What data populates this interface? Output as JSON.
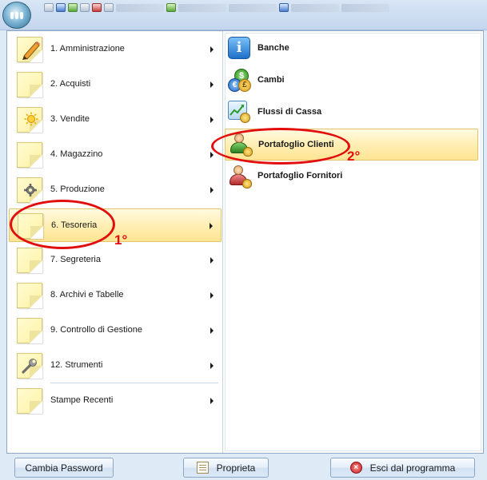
{
  "menu": {
    "items": [
      {
        "label": "1. Amministrazione",
        "icon": "pencil-note-icon"
      },
      {
        "label": "2. Acquisti",
        "icon": "note-icon"
      },
      {
        "label": "3. Vendite",
        "icon": "sun-note-icon"
      },
      {
        "label": "4. Magazzino",
        "icon": "note-icon"
      },
      {
        "label": "5. Produzione",
        "icon": "gear-note-icon"
      },
      {
        "label": "6. Tesoreria",
        "icon": "note-icon",
        "selected": true
      },
      {
        "label": "7. Segreteria",
        "icon": "note-icon"
      },
      {
        "label": "8. Archivi e Tabelle",
        "icon": "note-icon"
      },
      {
        "label": "9. Controllo di Gestione",
        "icon": "note-icon"
      },
      {
        "label": "12. Strumenti",
        "icon": "wrench-note-icon"
      },
      {
        "label": "Stampe Recenti",
        "icon": "note-icon"
      }
    ]
  },
  "submenu": {
    "items": [
      {
        "label": "Banche",
        "icon": "info-icon"
      },
      {
        "label": "Cambi",
        "icon": "currency-coins-icon"
      },
      {
        "label": "Flussi di Cassa",
        "icon": "cash-flow-chart-icon"
      },
      {
        "label": "Portafoglio Clienti",
        "icon": "customer-portfolio-icon",
        "selected": true
      },
      {
        "label": "Portafoglio Fornitori",
        "icon": "supplier-portfolio-icon"
      }
    ]
  },
  "footer": {
    "change_password": "Cambia Password",
    "properties": "Proprieta",
    "exit": "Esci dal programma"
  },
  "annotations": {
    "first": "1°",
    "second": "2°"
  },
  "colors": {
    "highlight": "#ffe593",
    "annotation": "#e20e0e",
    "frame": "#8fa8c8"
  }
}
